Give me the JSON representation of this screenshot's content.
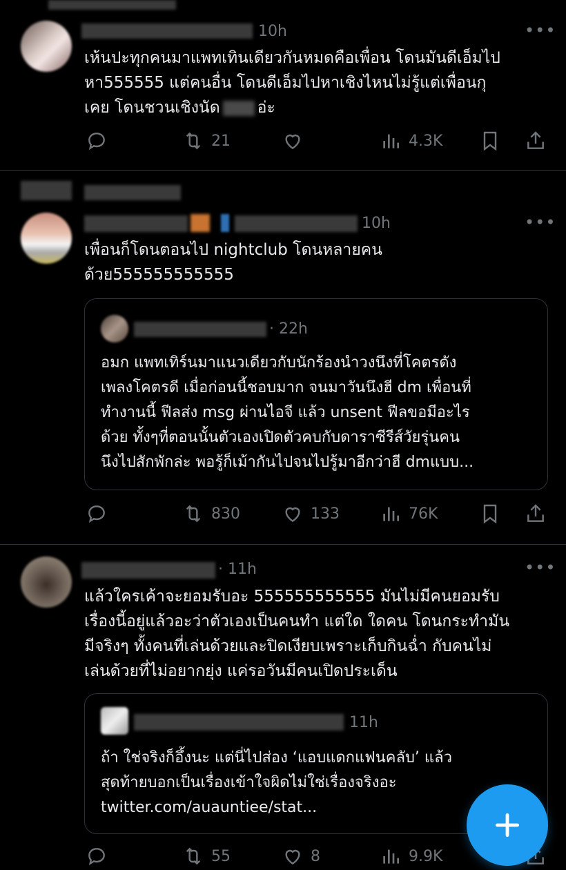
{
  "tweets": [
    {
      "time": "10h",
      "more": "•••",
      "lines": [
        "เห้นปะทุกคนมาแพทเทินเดียวกันหมดคือเพื่อน โดนมันดีเอ็มไป",
        "หา555555 แต่คนอื่น โดนดีเอ็มไปหาเชิงไหนไม่รู้แต่เพื่อนกุ",
        "เคย โดนชวนเชิงนัด",
        "อ่ะ"
      ],
      "actions": {
        "reply": "",
        "retweet": "21",
        "like": "",
        "views": "4.3K"
      }
    },
    {
      "time": "10h",
      "more": "•••",
      "lines": [
        "เพื่อนก็โดนตอนไป nightclub โดนหลายคน",
        "ด้วย555555555555"
      ],
      "quote": {
        "time": "22h",
        "lines": [
          "อมก แพทเทิร์นมาแนวเดียวกับนักร้องนำวงนึงที่โคตรดัง",
          "เพลงโคตรดี เมื่อก่อนนี้ชอบมาก จนมาวันนึงฮี dm เพื่อนที่",
          "ทำงานนี้ ฟีลส่ง msg ผ่านไอจี แล้ว unsent ฟีลขอมีอะไร",
          "ด้วย ทั้งๆที่ตอนนั้นตัวเองเปิดตัวคบกับดาราซีรีส์วัยรุ่นคน",
          "นึงไปสักพักล่ะ พอรู้ก็เม้ากันไปจนไปรู้มาอีกว่าฮี dmแบบ..."
        ]
      },
      "actions": {
        "reply": "",
        "retweet": "830",
        "like": "133",
        "views": "76K"
      }
    },
    {
      "time": "11h",
      "more": "•••",
      "lines": [
        "แล้วใครเค้าจะยอมรับอะ 555555555555 มันไม่มีคนยอมรับ",
        "เรื่องนี้อยู่แล้วอะว่าตัวเองเป็นคนทำ แต่ใด ใดคน โดนกระทำมัน",
        "มีจริงๆ ทั้งคนที่เล่นด้วยและปิดเงียบเพราะเก็บกินฉ่ำ กับคนไม่",
        "เล่นด้วยที่ไม่อยากยุ่ง แค่รอวันมีคนเปิดประเด็น"
      ],
      "quote": {
        "time": "11h",
        "lines": [
          "ถ้า ใช่จริงก็อึ้งนะ แต่นี่ไปส่อง ‘แอบแดกแฟนคลับ’ แล้ว",
          "สุดท้ายบอกเป็นเรื่องเข้าใจผิดไม่ใช่เรื่องจริงอะ",
          "twitter.com/auauntiee/stat..."
        ]
      },
      "actions": {
        "reply": "",
        "retweet": "55",
        "like": "8",
        "views": "9.9K"
      }
    }
  ],
  "fab": {
    "icon": "plus-icon",
    "color": "#1d9bf0"
  },
  "colors": {
    "background": "#000000",
    "text": "#e7e9ea",
    "muted": "#71767b",
    "accent": "#1d9bf0"
  }
}
